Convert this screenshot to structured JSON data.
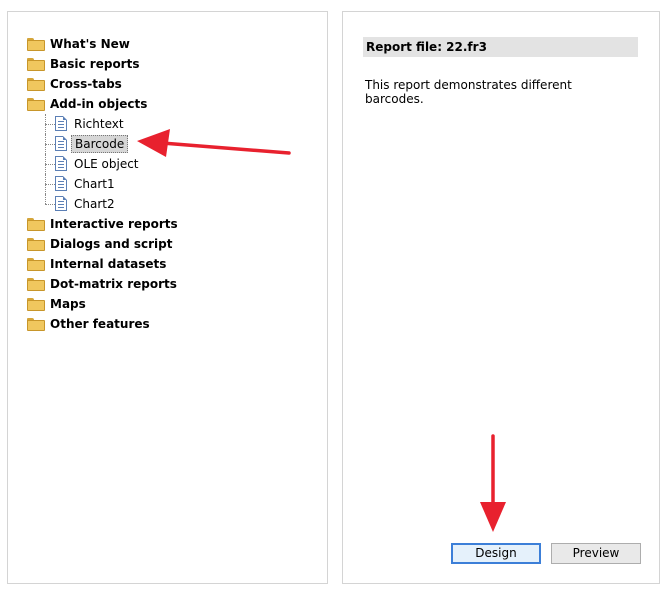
{
  "tree": {
    "folders_top": [
      "What's New",
      "Basic reports",
      "Cross-tabs",
      "Add-in objects"
    ],
    "addin_children": [
      "Richtext",
      "Barcode",
      "OLE object",
      "Chart1",
      "Chart2"
    ],
    "selected": "Barcode",
    "folders_bottom": [
      "Interactive reports",
      "Dialogs and script",
      "Internal datasets",
      "Dot-matrix reports",
      "Maps",
      "Other features"
    ]
  },
  "details": {
    "header": "Report file: 22.fr3",
    "description": "This report demonstrates different barcodes."
  },
  "buttons": {
    "design": "Design",
    "preview": "Preview"
  },
  "colors": {
    "arrow": "#e8212e",
    "folder": "#f0c75e",
    "selection": "#d6d6d6",
    "header_bg": "#e3e3e3",
    "focus_border": "#3c7fd8"
  },
  "icons": {
    "folder": "folder-icon",
    "document": "document-icon"
  }
}
